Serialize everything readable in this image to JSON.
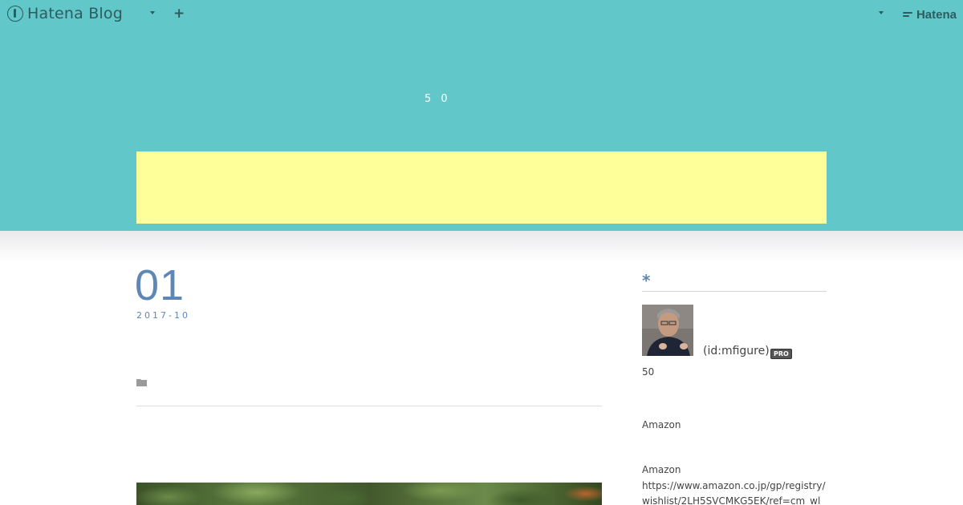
{
  "toolbar": {
    "logo_text": "Hatena Blog",
    "add_label": "+",
    "brand_label": "Hatena"
  },
  "blog": {
    "title": "5 0"
  },
  "article": {
    "day": "01",
    "year_month": "2017-10"
  },
  "sidebar": {
    "heading_mark": "*",
    "profile": {
      "user_id": "(id:mfigure)",
      "badge": "PRO",
      "age_text": "50"
    },
    "amazon_label_1": "Amazon",
    "amazon_label_2": "Amazon",
    "wishlist_url": "https://www.amazon.co.jp/gp/registry/wishlist/2LH5SVCMKG5EK/ref=cm_wl_"
  },
  "colors": {
    "header_bg": "#62c7c9",
    "banner_bg": "#ffff99",
    "accent": "#5f87b5"
  }
}
